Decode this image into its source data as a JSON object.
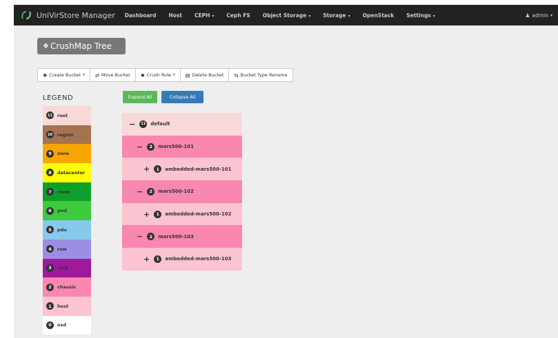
{
  "navbar": {
    "brand": "UniVirStore Manager",
    "items": [
      {
        "label": "Dashboard",
        "caret": false
      },
      {
        "label": "Host",
        "caret": false
      },
      {
        "label": "CEPH",
        "caret": true
      },
      {
        "label": "Ceph FS",
        "caret": false
      },
      {
        "label": "Object Storage",
        "caret": true
      },
      {
        "label": "Storage",
        "caret": true
      },
      {
        "label": "OpenStack",
        "caret": false
      },
      {
        "label": "Settings",
        "caret": true
      }
    ],
    "user": "admin"
  },
  "page": {
    "title": "CrushMap Tree"
  },
  "toolbar": {
    "create_bucket": "Create Bucket",
    "move_bucket": "Move Bucket",
    "crush_rule": "Crush Rule",
    "delete_bucket": "Delete Bucket",
    "bucket_type_rename": "Bucket Type Rename"
  },
  "legend": {
    "title": "LEGEND",
    "items": [
      {
        "num": "11",
        "label": "root",
        "color": "#f9d8d8"
      },
      {
        "num": "10",
        "label": "region",
        "color": "#a57350"
      },
      {
        "num": "9",
        "label": "zone",
        "color": "#f9a500"
      },
      {
        "num": "8",
        "label": "datacenter",
        "color": "#ffff00"
      },
      {
        "num": "7",
        "label": "room",
        "color": "#0da02c"
      },
      {
        "num": "6",
        "label": "pod",
        "color": "#3fc93f"
      },
      {
        "num": "5",
        "label": "pdu",
        "color": "#87c9ea"
      },
      {
        "num": "4",
        "label": "row",
        "color": "#9c8fe3"
      },
      {
        "num": "3",
        "label": "rack",
        "color": "#a0189b"
      },
      {
        "num": "2",
        "label": "chassis",
        "color": "#f987af"
      },
      {
        "num": "1",
        "label": "host",
        "color": "#fcc4d0"
      },
      {
        "num": "0",
        "label": "osd",
        "color": "#ffffff"
      }
    ]
  },
  "actions": {
    "expand_all": "Expand All",
    "collapse_all": "Collapse All"
  },
  "tree": [
    {
      "toggle": "−",
      "num": "11",
      "label": "default",
      "level": 0,
      "color": "#f9d8d8"
    },
    {
      "toggle": "−",
      "num": "2",
      "label": "mars500-101",
      "level": 1,
      "color": "#f987af"
    },
    {
      "toggle": "+",
      "num": "1",
      "label": "ambedded-mars500-101",
      "level": 2,
      "color": "#fcc4d0"
    },
    {
      "toggle": "−",
      "num": "2",
      "label": "mars500-102",
      "level": 1,
      "color": "#f987af"
    },
    {
      "toggle": "+",
      "num": "1",
      "label": "ambedded-mars500-102",
      "level": 2,
      "color": "#fcc4d0"
    },
    {
      "toggle": "−",
      "num": "2",
      "label": "mars500-103",
      "level": 1,
      "color": "#f987af"
    },
    {
      "toggle": "+",
      "num": "1",
      "label": "ambedded-mars500-103",
      "level": 2,
      "color": "#fcc4d0"
    }
  ]
}
